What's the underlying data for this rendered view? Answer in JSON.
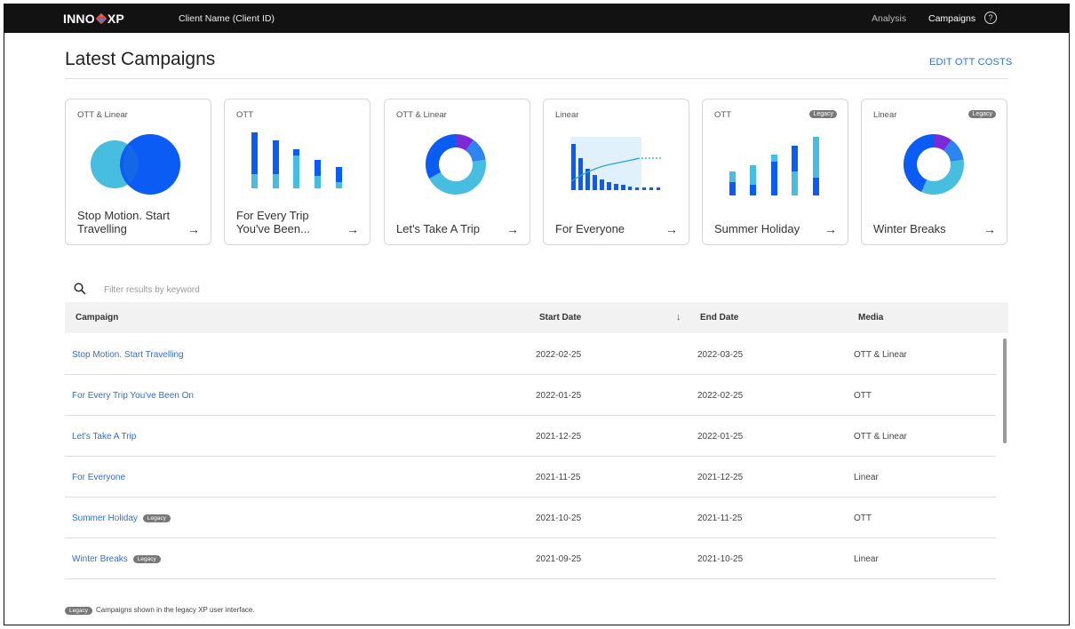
{
  "header": {
    "logo_text_left": "INNO",
    "logo_text_right": "XP",
    "client": "Client Name (Client ID)",
    "nav": [
      "Analysis",
      "Campaigns"
    ],
    "help": "?"
  },
  "page": {
    "title": "Latest Campaigns",
    "edit_link": "EDIT OTT COSTS"
  },
  "colors": {
    "primary_blue": "#0a5cf5",
    "light_blue": "#47bde0",
    "purple": "#7a2bd6",
    "link": "#2c6fdc"
  },
  "cards": [
    {
      "media": "OTT & Linear",
      "name": "Stop Motion. Start Travelling",
      "legacy": "",
      "chart": "venn"
    },
    {
      "media": "OTT",
      "name": "For Every Trip You've Been...",
      "legacy": "",
      "chart": "stacked-bars"
    },
    {
      "media": "OTT & Linear",
      "name": "Let's Take A Trip",
      "legacy": "",
      "chart": "donut"
    },
    {
      "media": "Linear",
      "name": "For Everyone",
      "legacy": "",
      "chart": "bars-line"
    },
    {
      "media": "OTT",
      "name": "Summer Holiday",
      "legacy": "Legacy",
      "chart": "rising-bars"
    },
    {
      "media": "Linear",
      "name": "Winter Breaks",
      "legacy": "Legacy",
      "chart": "donut"
    }
  ],
  "card_arrow": "→",
  "search": {
    "placeholder": "Filter results by keyword",
    "value": ""
  },
  "table": {
    "columns": [
      "Campaign",
      "Start Date",
      "End Date",
      "Media"
    ],
    "sort_indicator": "↓",
    "rows": [
      {
        "campaign": "Stop Motion. Start Travelling",
        "badge": "",
        "start": "2022-02-25",
        "end": "2022-03-25",
        "media": "OTT & Linear"
      },
      {
        "campaign": "For Every Trip You've Been On",
        "badge": "",
        "start": "2022-01-25",
        "end": "2022-02-25",
        "media": "OTT"
      },
      {
        "campaign": "Let's Take A Trip",
        "badge": "",
        "start": "2021-12-25",
        "end": "2022-01-25",
        "media": "OTT & Linear"
      },
      {
        "campaign": "For Everyone",
        "badge": "",
        "start": "2021-11-25",
        "end": "2021-12-25",
        "media": "Linear"
      },
      {
        "campaign": "Summer Holiday",
        "badge": "Legacy",
        "start": "2021-10-25",
        "end": "2021-11-25",
        "media": "OTT"
      },
      {
        "campaign": "Winter Breaks",
        "badge": "Legacy",
        "start": "2021-09-25",
        "end": "2021-10-25",
        "media": "Linear"
      }
    ]
  },
  "footnote": {
    "badge": "Legacy",
    "text": "Campaigns shown in the legacy XP user interface."
  }
}
